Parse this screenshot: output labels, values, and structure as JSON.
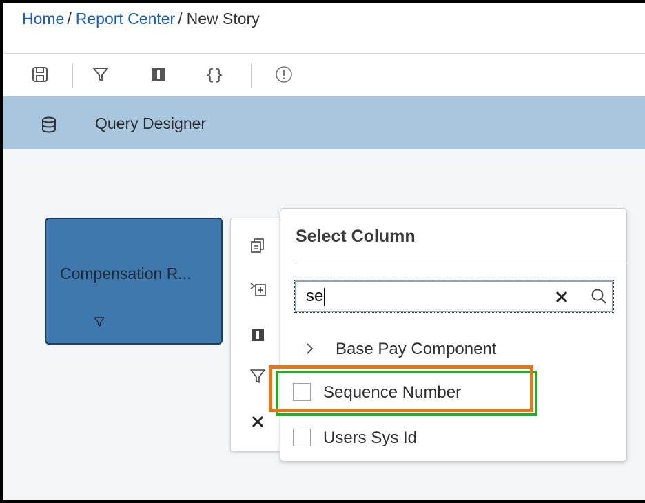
{
  "breadcrumb": {
    "home": "Home",
    "report_center": "Report Center",
    "current": "New Story",
    "separator": "/"
  },
  "toolbar": {
    "icons": [
      "save-icon",
      "filter-icon",
      "columns-icon",
      "braces-icon",
      "warning-icon"
    ]
  },
  "query_designer": {
    "label": "Query Designer",
    "icon": "database-icon"
  },
  "node": {
    "title": "Compensation R...",
    "color": "#3e78ad"
  },
  "actions": {
    "icons": [
      "copy-icon",
      "add-field-icon",
      "columns-icon",
      "filter-icon",
      "close-icon"
    ]
  },
  "select_column": {
    "title": "Select Column",
    "search_value": "se",
    "items": [
      {
        "type": "group",
        "label": "Base Pay Component"
      },
      {
        "type": "checkbox",
        "label": "Sequence Number",
        "checked": false
      },
      {
        "type": "checkbox",
        "label": "Users Sys Id",
        "checked": false
      }
    ]
  },
  "colors": {
    "link": "#1a5fb0",
    "header_bar": "#a9c6df",
    "highlight_orange": "#e0781a",
    "highlight_green": "#2ea62a"
  }
}
